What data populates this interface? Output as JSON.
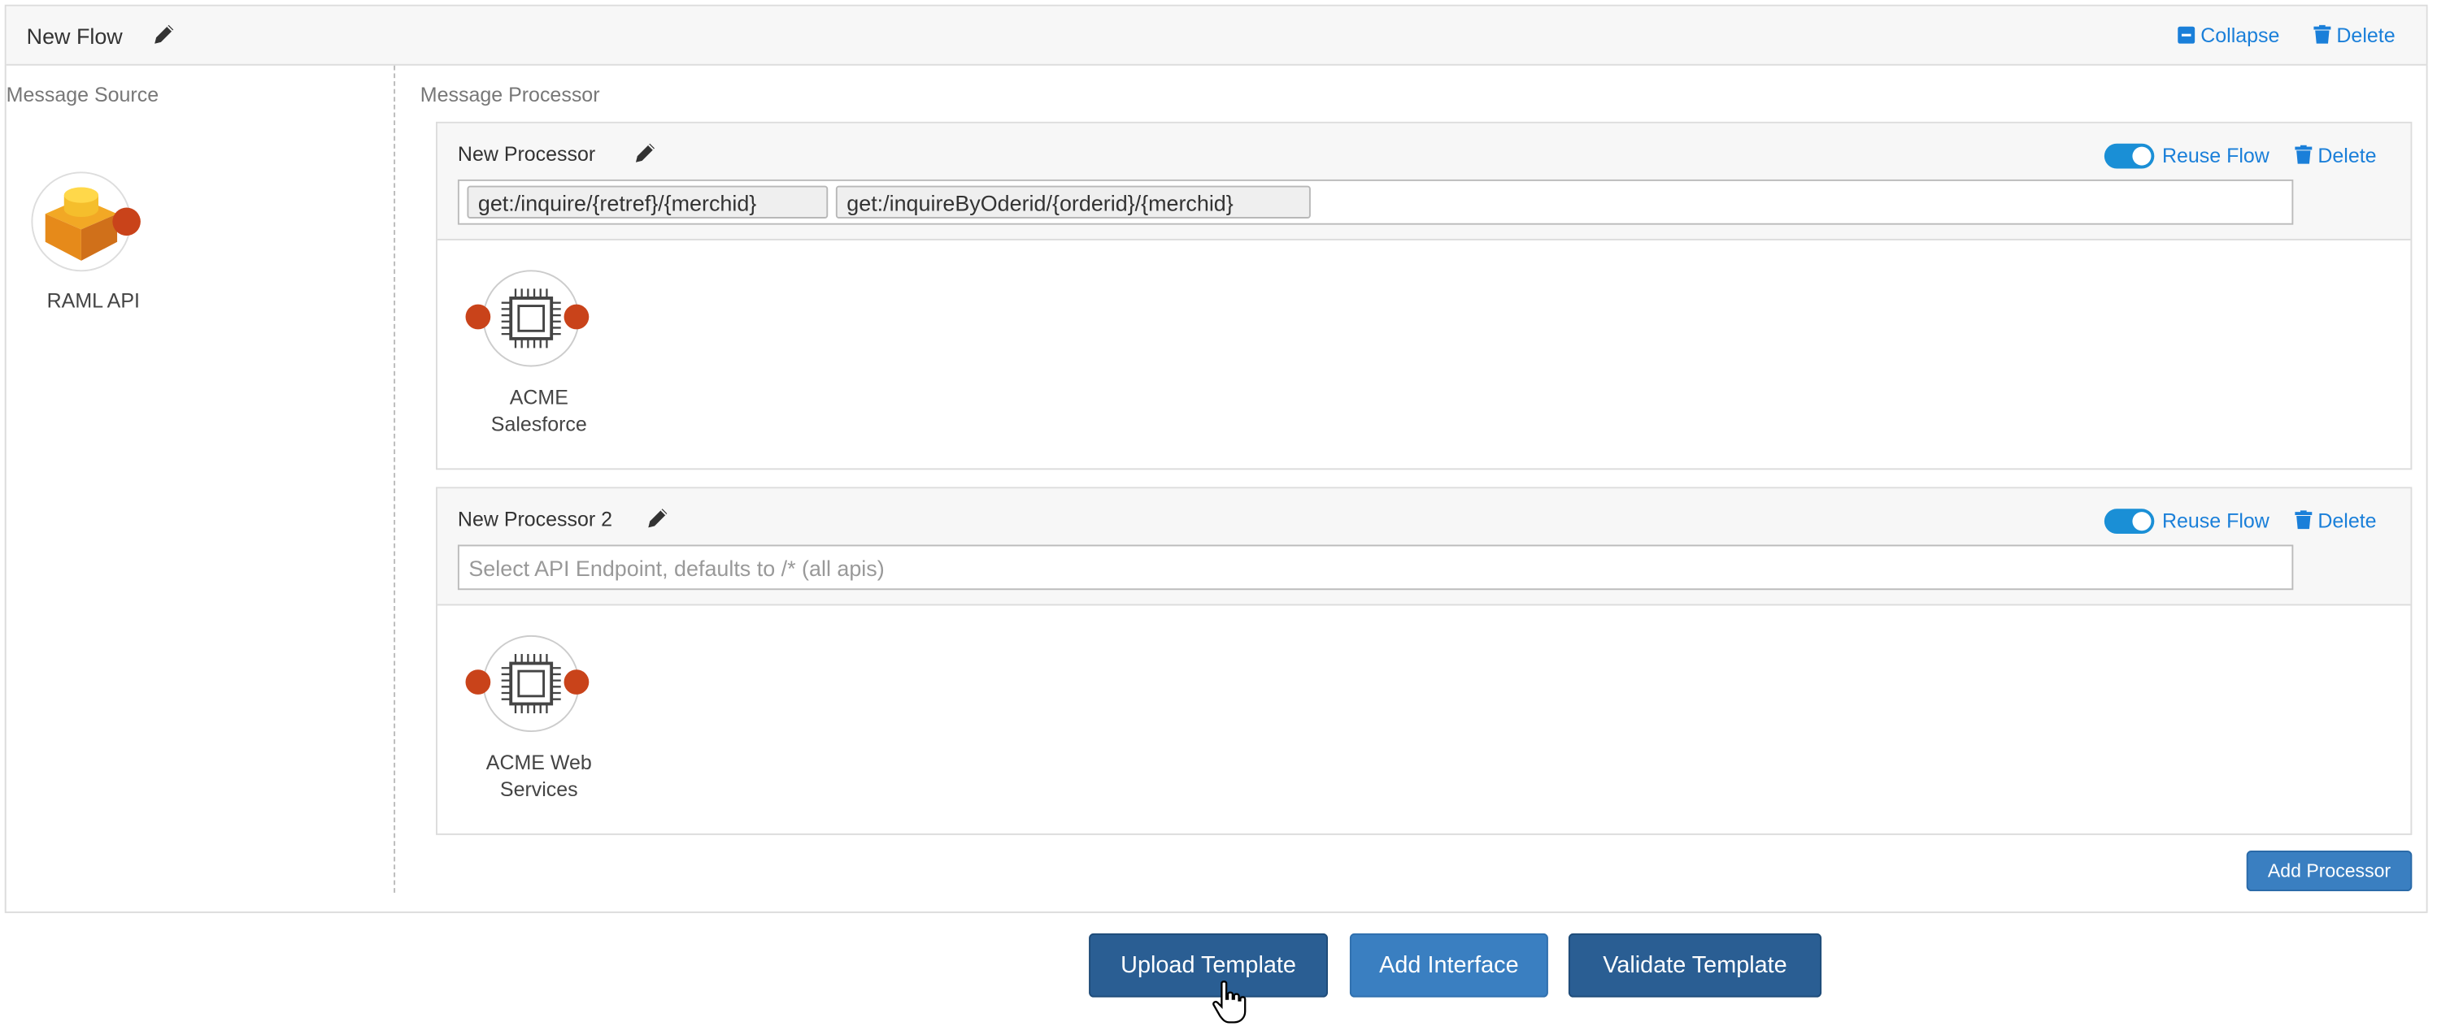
{
  "flow": {
    "title": "New Flow",
    "collapse_label": "Collapse",
    "delete_label": "Delete",
    "source_section_label": "Message Source",
    "processor_section_label": "Message Processor"
  },
  "source": {
    "label": "RAML API"
  },
  "processors": [
    {
      "title": "New Processor",
      "reuse_label": "Reuse Flow",
      "delete_label": "Delete",
      "endpoints": [
        "get:/inquire/{retref}/{merchid}",
        "get:/inquireByOderid/{orderid}/{merchid}"
      ],
      "node_label_line1": "ACME",
      "node_label_line2": "Salesforce"
    },
    {
      "title": "New Processor 2",
      "reuse_label": "Reuse Flow",
      "delete_label": "Delete",
      "endpoint_placeholder": "Select API Endpoint, defaults to /* (all apis)",
      "node_label_line1": "ACME Web",
      "node_label_line2": "Services"
    }
  ],
  "buttons": {
    "add_processor": "Add Processor",
    "upload_template": "Upload Template",
    "add_interface": "Add Interface",
    "validate_template": "Validate Template"
  },
  "colors": {
    "link": "#1a7fd9",
    "connector": "#c9431a",
    "primary_dark": "#2a5e93",
    "primary": "#3a7fc1",
    "toggle": "#1a8fd6"
  }
}
